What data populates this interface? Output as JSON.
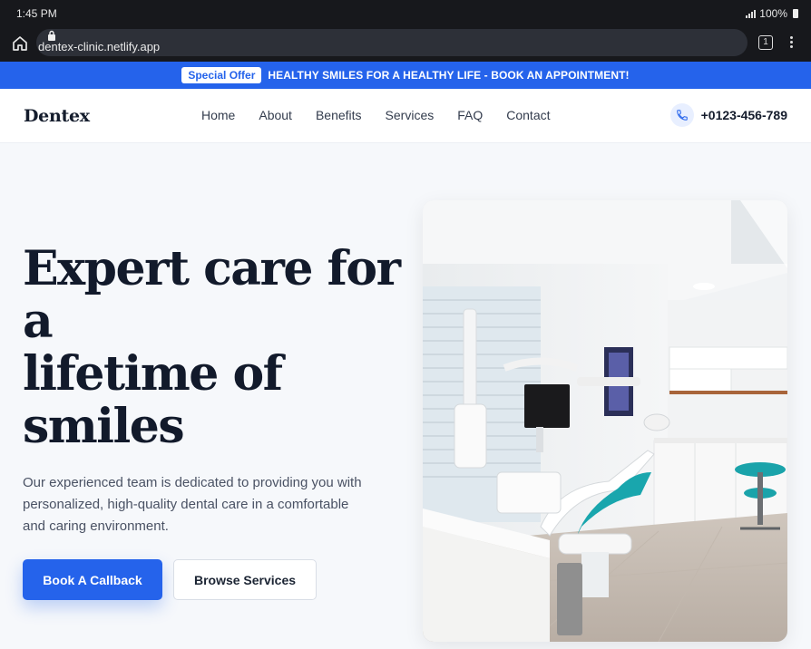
{
  "status_bar": {
    "time": "1:45 PM",
    "battery": "100%"
  },
  "browser": {
    "url": "dentex-clinic.netlify.app",
    "tab_count": "1"
  },
  "announcement": {
    "badge": "Special Offer",
    "text": "HEALTHY SMILES FOR A HEALTHY LIFE - BOOK AN APPOINTMENT!"
  },
  "header": {
    "logo": "Dentex",
    "nav": [
      "Home",
      "About",
      "Benefits",
      "Services",
      "FAQ",
      "Contact"
    ],
    "phone": "+0123-456-789"
  },
  "hero": {
    "title_lines": [
      "Expert care for",
      "a",
      "lifetime of",
      "smiles"
    ],
    "description_lines": [
      "Our experienced team is dedicated to providing you with",
      "personalized, high-quality dental care in a comfortable",
      "and caring environment."
    ],
    "primary_button": "Book A Callback",
    "secondary_button": "Browse Services"
  },
  "colors": {
    "brand": "#2563eb",
    "text_dark": "#121a2b",
    "chrome": "#17181c"
  },
  "icons": [
    "home-icon",
    "lock-icon",
    "tabs-icon",
    "more-vert-icon",
    "phone-icon",
    "signal-icon",
    "battery-icon"
  ]
}
